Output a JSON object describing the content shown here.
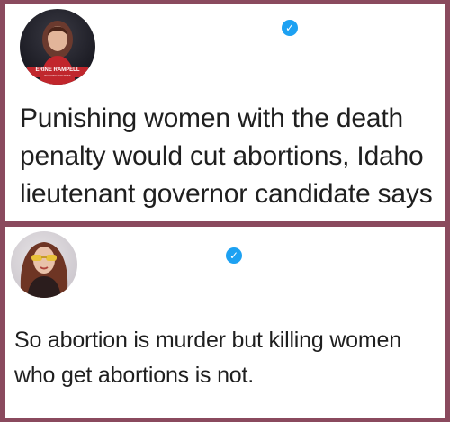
{
  "tweets": [
    {
      "text": "Punishing women with the death penalty would cut abortions, Idaho lieutenant governor candidate says",
      "avatar": {
        "caption": "ERINE RAMPELL",
        "sub_caption": "WASHINGTON POST"
      }
    },
    {
      "text": "So abortion is murder but killing women who get abortions is not."
    }
  ],
  "icons": {
    "verified": "verified-badge-icon",
    "check": "✓"
  },
  "colors": {
    "frame": "#8a4a5e",
    "panel": "#ffffff",
    "verified_badge": "#1da1f2"
  }
}
